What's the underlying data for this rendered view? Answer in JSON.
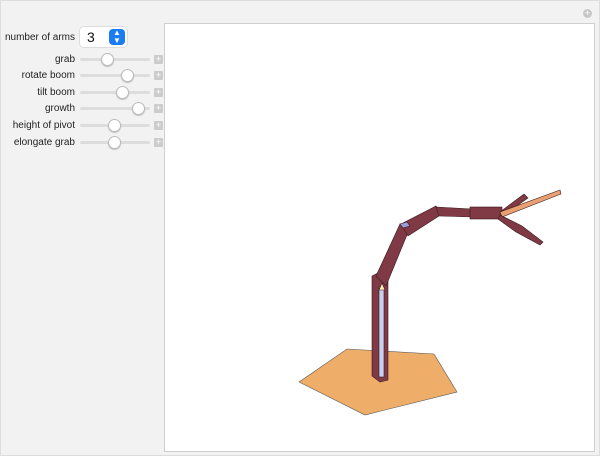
{
  "controls": {
    "number_of_arms": {
      "label": "number of arms",
      "value": "3"
    },
    "sliders": [
      {
        "label": "grab",
        "value": 0.38
      },
      {
        "label": "rotate boom",
        "value": 0.67
      },
      {
        "label": "tilt boom",
        "value": 0.6
      },
      {
        "label": "growth",
        "value": 0.83
      },
      {
        "label": "height of pivot",
        "value": 0.49
      },
      {
        "label": "elongate grab",
        "value": 0.49
      }
    ],
    "plus_symbol": "+"
  },
  "colors": {
    "base": "#eeae6a",
    "arm": "#7f3a45",
    "inner": "#c8d0f0",
    "accent": "#1a7cf5"
  }
}
